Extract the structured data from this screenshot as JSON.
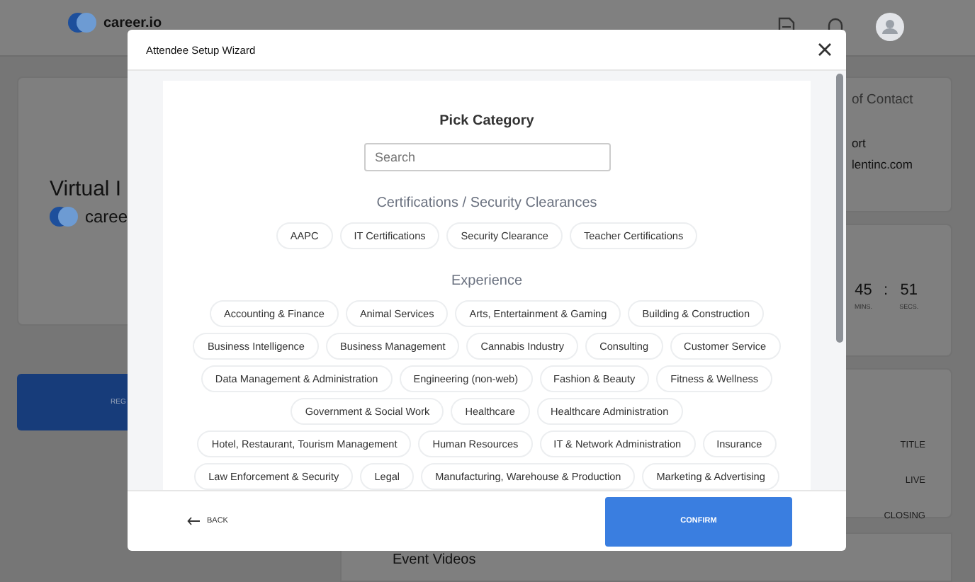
{
  "header": {
    "logo": "career.io"
  },
  "event": {
    "title": "Virtual I",
    "organizer": "caree",
    "register_button": "REG"
  },
  "contact": {
    "title": "of Contact",
    "lines": [
      "ort",
      "lentinc.com"
    ]
  },
  "countdown": {
    "separator": ":",
    "units": [
      {
        "value": "45",
        "label": "MINS."
      },
      {
        "value": "51",
        "label": "SECS."
      }
    ]
  },
  "schedule": {
    "rows": [
      "TITLE",
      "LIVE",
      "CLOSING"
    ]
  },
  "videos": {
    "title": "Event Videos"
  },
  "modal": {
    "title": "Attendee Setup Wizard",
    "heading": "Pick Category",
    "search": {
      "placeholder": "Search"
    },
    "sections": [
      {
        "title": "Certifications / Security Clearances",
        "chips": [
          "AAPC",
          "IT Certifications",
          "Security Clearance",
          "Teacher Certifications"
        ]
      },
      {
        "title": "Experience",
        "chips": [
          "Accounting & Finance",
          "Animal Services",
          "Arts, Entertainment & Gaming",
          "Building & Construction",
          "Business Intelligence",
          "Business Management",
          "Cannabis Industry",
          "Consulting",
          "Customer Service",
          "Data Management & Administration",
          "Engineering (non-web)",
          "Fashion & Beauty",
          "Fitness & Wellness",
          "Government & Social Work",
          "Healthcare",
          "Healthcare Administration",
          "Hotel, Restaurant, Tourism Management",
          "Human Resources",
          "IT & Network Administration",
          "Insurance",
          "Law Enforcement & Security",
          "Legal",
          "Manufacturing, Warehouse & Production",
          "Marketing & Advertising"
        ]
      }
    ],
    "back": "BACK",
    "confirm": "CONFIRM"
  }
}
